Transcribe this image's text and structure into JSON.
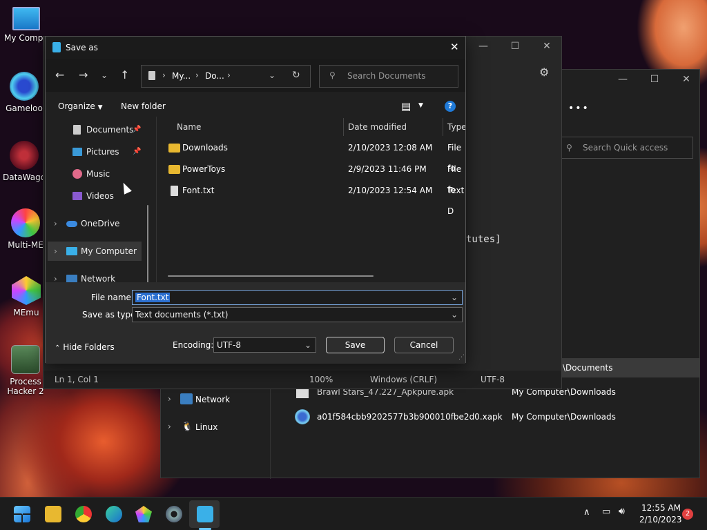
{
  "desktop": {
    "icons": [
      {
        "label": "My Compu"
      },
      {
        "label": "Gameloo"
      },
      {
        "label": "DataWago"
      },
      {
        "label": "Multi-ME"
      },
      {
        "label": "MEmu"
      },
      {
        "label": "Process Hacker 2"
      }
    ]
  },
  "bg_explorer": {
    "more_label": "•••",
    "search_placeholder": "Search Quick access",
    "tree": [
      {
        "label": "Network"
      },
      {
        "label": "Linux"
      }
    ],
    "rows": [
      {
        "name": "",
        "location": "\\Documents"
      },
      {
        "name": "Brawl Stars_47.227_Apkpure.apk",
        "location": "My Computer\\Downloads"
      },
      {
        "name": "a01f584cbb9202577b3b900010fbe2d0.xapk",
        "location": "My Computer\\Downloads"
      }
    ]
  },
  "notepad": {
    "text_fragment": "tutes]",
    "status": {
      "position": "Ln 1, Col 1",
      "zoom": "100%",
      "line_ending": "Windows (CRLF)",
      "encoding": "UTF-8"
    }
  },
  "dialog": {
    "title": "Save as",
    "address": {
      "seg1": "My...",
      "seg2": "Do..."
    },
    "search_placeholder": "Search Documents",
    "organize_label": "Organize",
    "new_folder_label": "New folder",
    "tree": [
      {
        "label": "Documents"
      },
      {
        "label": "Pictures"
      },
      {
        "label": "Music"
      },
      {
        "label": "Videos"
      },
      {
        "label": "OneDrive"
      },
      {
        "label": "My Computer"
      },
      {
        "label": "Network"
      }
    ],
    "columns": {
      "name": "Name",
      "date": "Date modified",
      "type": "Type"
    },
    "files": [
      {
        "name": "Downloads",
        "date": "2/10/2023 12:08 AM",
        "type": "File fo"
      },
      {
        "name": "PowerToys",
        "date": "2/9/2023 11:46 PM",
        "type": "File fo"
      },
      {
        "name": "Font.txt",
        "date": "2/10/2023 12:54 AM",
        "type": "Text D"
      }
    ],
    "file_name_label": "File name:",
    "file_name_value": "Font.txt",
    "save_type_label": "Save as type:",
    "save_type_value": "Text documents (*.txt)",
    "hide_folders_label": "Hide Folders",
    "encoding_label": "Encoding:",
    "encoding_value": "UTF-8",
    "save_label": "Save",
    "cancel_label": "Cancel"
  },
  "taskbar": {
    "time": "12:55 AM",
    "date": "2/10/2023",
    "notification_count": "2"
  }
}
